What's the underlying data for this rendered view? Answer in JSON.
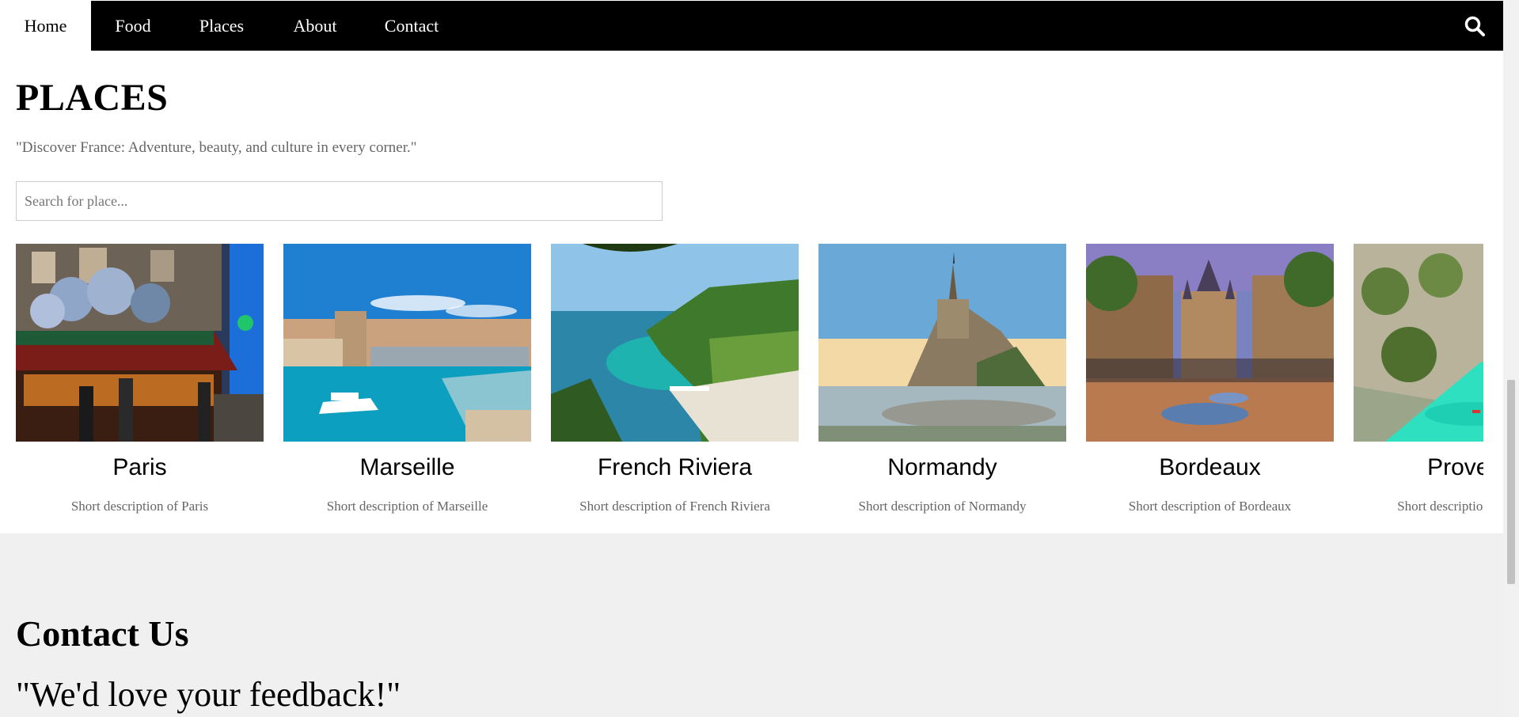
{
  "nav": {
    "items": [
      {
        "label": "Home",
        "active": true
      },
      {
        "label": "Food",
        "active": false
      },
      {
        "label": "Places",
        "active": false
      },
      {
        "label": "About",
        "active": false
      },
      {
        "label": "Contact",
        "active": false
      }
    ],
    "search_icon": "search-icon"
  },
  "places": {
    "title": "PLACES",
    "subtitle": "\"Discover France: Adventure, beauty, and culture in every corner.\"",
    "search": {
      "placeholder": "Search for place...",
      "value": ""
    },
    "cards": [
      {
        "name": "Paris",
        "description": "Short description of Paris"
      },
      {
        "name": "Marseille",
        "description": "Short description of Marseille"
      },
      {
        "name": "French Riviera",
        "description": "Short description of French Riviera"
      },
      {
        "name": "Normandy",
        "description": "Short description of Normandy"
      },
      {
        "name": "Bordeaux",
        "description": "Short description of Bordeaux"
      },
      {
        "name": "Provence",
        "description": "Short description of Provence"
      }
    ]
  },
  "contact": {
    "title": "Contact Us",
    "quote": "\"We'd love your feedback!\""
  },
  "colors": {
    "nav_bg": "#000000",
    "section_bg": "#f0f0f0",
    "muted_text": "#666666"
  }
}
